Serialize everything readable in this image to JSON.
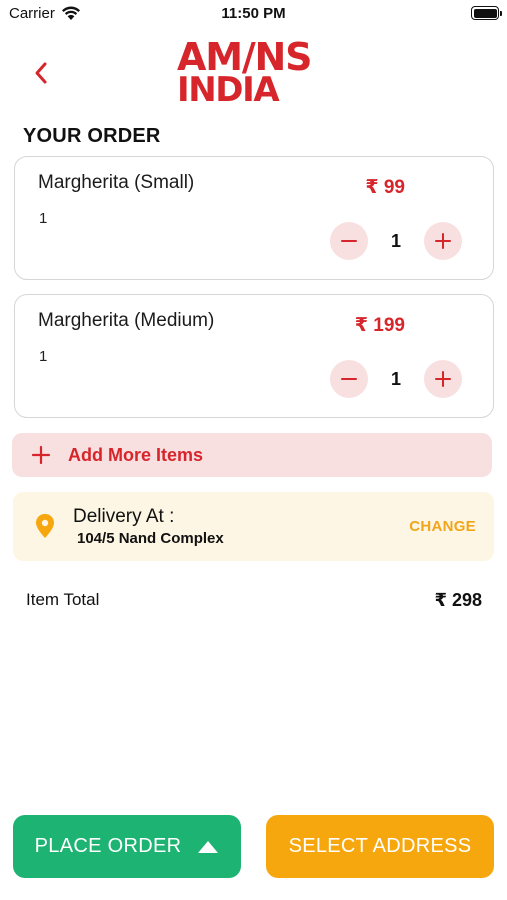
{
  "status_bar": {
    "carrier": "Carrier",
    "time": "11:50 PM"
  },
  "header": {
    "logo_line1": "AM/NS",
    "logo_line2": "INDIA",
    "back_icon": "chevron-left-icon"
  },
  "section_title": "YOUR ORDER",
  "order_items": [
    {
      "name": "Margherita (Small)",
      "qty_text": "1",
      "price": "₹ 99",
      "quantity": "1"
    },
    {
      "name": "Margherita (Medium)",
      "qty_text": "1",
      "price": "₹ 199",
      "quantity": "1"
    }
  ],
  "add_more": {
    "label": "Add More Items",
    "icon": "plus-icon"
  },
  "delivery": {
    "label": "Delivery At :",
    "address": "104/5 Nand Complex",
    "change_label": "CHANGE",
    "icon": "location-pin-icon"
  },
  "totals": {
    "label": "Item Total",
    "value": "₹ 298"
  },
  "buttons": {
    "place_order": "PLACE ORDER",
    "select_address": "SELECT ADDRESS"
  },
  "colors": {
    "brand_red": "#d7262b",
    "green": "#1db372",
    "orange": "#f7a70e",
    "pink_tint": "#f8dfe0",
    "cream": "#fdf6e4"
  }
}
